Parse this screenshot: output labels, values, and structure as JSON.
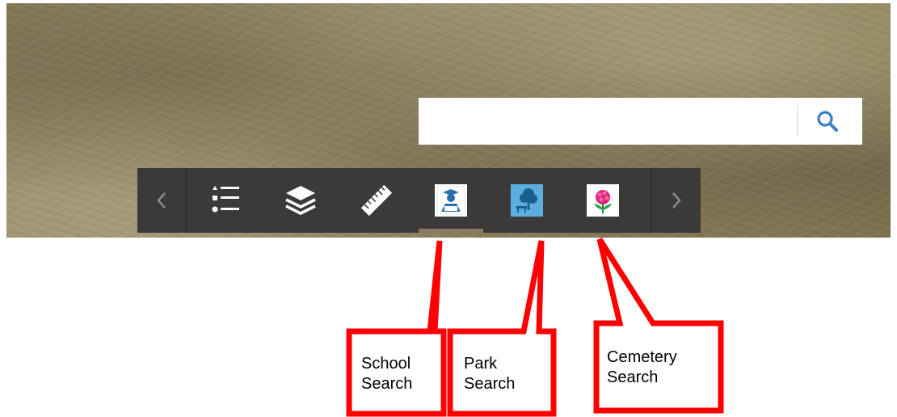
{
  "search": {
    "value": "",
    "placeholder": "",
    "button_icon": "search-icon"
  },
  "toolbar": {
    "items": [
      {
        "icon": "chevron-left-icon",
        "role": "scroll-left"
      },
      {
        "icon": "legend-list-icon",
        "role": "legend"
      },
      {
        "icon": "layers-icon",
        "role": "layers"
      },
      {
        "icon": "ruler-icon",
        "role": "measure"
      },
      {
        "icon": "school-search-icon",
        "role": "school-search",
        "active": true
      },
      {
        "icon": "park-search-icon",
        "role": "park-search"
      },
      {
        "icon": "cemetery-search-icon",
        "role": "cemetery-search"
      },
      {
        "icon": "chevron-right-icon",
        "role": "scroll-right"
      }
    ]
  },
  "callouts": {
    "school": {
      "line1": "School",
      "line2": "Search"
    },
    "park": {
      "line1": "Park",
      "line2": "Search"
    },
    "cemetery": {
      "line1": "Cemetery",
      "line2": "Search"
    }
  },
  "colors": {
    "toolbar_bg": "#3b3a38",
    "active_indicator": "#8a7a63",
    "callout_stroke": "#ff0000",
    "search_icon": "#3a7fc4",
    "park_icon_bg": "#5aaee0"
  }
}
